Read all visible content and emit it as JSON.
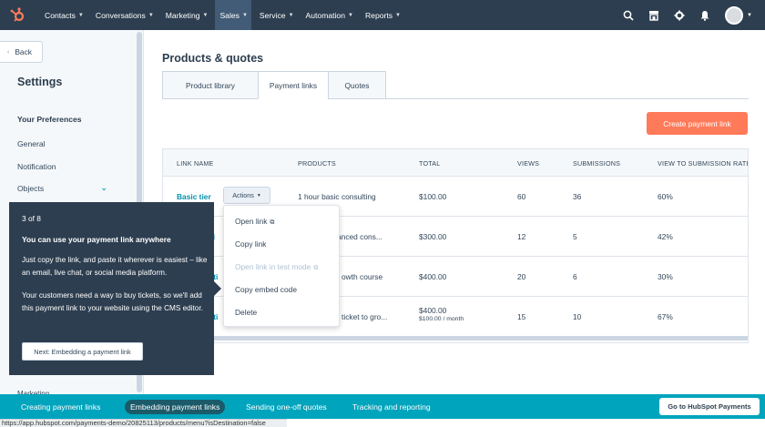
{
  "topnav": {
    "logo_icon": "hubspot-sprocket-icon",
    "items": [
      {
        "label": "Contacts"
      },
      {
        "label": "Conversations"
      },
      {
        "label": "Marketing"
      },
      {
        "label": "Sales"
      },
      {
        "label": "Service"
      },
      {
        "label": "Automation"
      },
      {
        "label": "Reports"
      }
    ],
    "active_item": "Sales",
    "right_icons": [
      "search-icon",
      "marketplace-icon",
      "settings-gear-icon",
      "notifications-bell-icon",
      "user-avatar"
    ]
  },
  "sidebar": {
    "back_label": "Back",
    "title": "Settings",
    "section_title": "Your Preferences",
    "links": [
      "General",
      "Notification",
      "Objects"
    ],
    "marketing_label": "Marketing"
  },
  "main": {
    "title": "Products & quotes",
    "tabs": [
      {
        "label": "Product library"
      },
      {
        "label": "Payment links"
      },
      {
        "label": "Quotes"
      }
    ],
    "active_tab": "Payment links",
    "create_button": "Create payment link"
  },
  "table": {
    "headers": [
      "LINK NAME",
      "PRODUCTS",
      "TOTAL",
      "VIEWS",
      "SUBMISSIONS",
      "VIEW TO SUBMISSION RATE"
    ],
    "actions_label": "Actions",
    "rows": [
      {
        "name": "Basic tier",
        "product": "1 hour basic consulting",
        "total": "$100.00",
        "total_sub": "",
        "views": "60",
        "submissions": "36",
        "rate": "60%"
      },
      {
        "name": "ti",
        "product": "anced cons...",
        "total": "$300.00",
        "total_sub": "",
        "views": "12",
        "submissions": "5",
        "rate": "42%"
      },
      {
        "name": "rti",
        "product": "owth course",
        "total": "$400.00",
        "total_sub": "",
        "views": "20",
        "submissions": "6",
        "rate": "30%"
      },
      {
        "name": "rti",
        "product": "ticket to gro...",
        "total": "$400.00",
        "total_sub": "$100.00 / month",
        "views": "15",
        "submissions": "10",
        "rate": "67%"
      }
    ]
  },
  "dropdown": {
    "items": [
      {
        "label": "Open link",
        "disabled": false,
        "external": true
      },
      {
        "label": "Copy link",
        "disabled": false,
        "external": false
      },
      {
        "label": "Open link in test mode",
        "disabled": true,
        "external": true
      },
      {
        "label": "Copy embed code",
        "disabled": false,
        "external": false
      },
      {
        "label": "Delete",
        "disabled": false,
        "external": false
      }
    ]
  },
  "tooltip": {
    "count": "3 of 8",
    "title": "You can use your payment link anywhere",
    "paragraph1": "Just copy the link, and paste it wherever is easiest – like an email, live chat, or social media platform.",
    "paragraph2": "Your customers need a way to buy tickets, so we'll add this payment link to your website using the CMS editor.",
    "button": "Next: Embedding a payment link"
  },
  "bottombar": {
    "links": [
      "Creating payment links",
      "Embedding payment links",
      "Sending one-off quotes",
      "Tracking and reporting"
    ],
    "active_link": "Embedding payment links",
    "button": "Go to HubSpot Payments"
  },
  "status_url": "https://app.hubspot.com/payments-demo/20825113/products/menu?isDestination=false",
  "colors": {
    "nav_bg": "#2d3e50",
    "accent_orange": "#ff7a59",
    "link_teal": "#0091ae",
    "bottom_bar": "#00a4bd"
  }
}
